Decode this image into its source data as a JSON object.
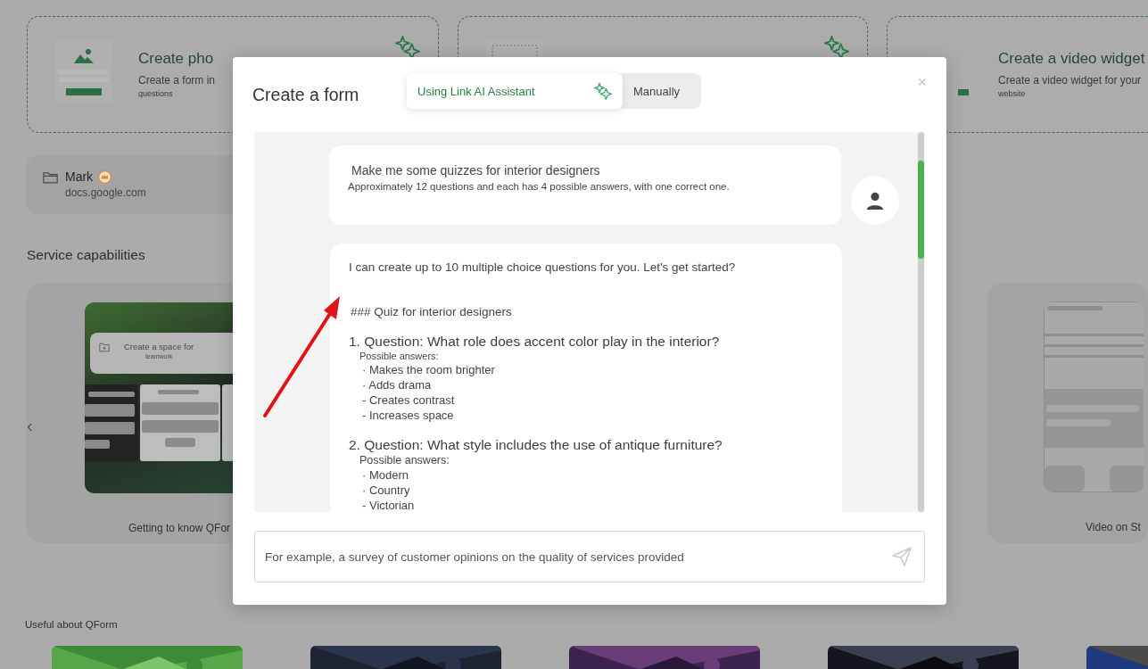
{
  "background": {
    "top_cards": [
      {
        "title": "Create pho",
        "description": "Create a form in",
        "subtext": "questions",
        "sparkle": true
      },
      {
        "kind": "grid",
        "sparkle": true
      },
      {
        "kind": "video",
        "title": "Create a video widget",
        "description": "Create a video widget for your",
        "subtext": "website",
        "sparkle": false
      }
    ],
    "folder": {
      "name": "Mark",
      "url": "docs.google.com",
      "premium": true
    },
    "section_title": "Service capabilities",
    "carousel_prev": "‹",
    "capability_cards": [
      {
        "caption": "Getting to know QFor",
        "preview": {
          "kind": "teamwork",
          "title": "Create a space for",
          "subtitle": "teamwork"
        }
      },
      {
        "caption": "Video on St",
        "preview": {
          "kind": "form"
        }
      }
    ],
    "useful_title": "Useful about QForm"
  },
  "modal": {
    "title": "Create a form",
    "close": "×",
    "modes": [
      {
        "label": "Using Link AI Assistant",
        "selected": true
      },
      {
        "label": "Manually",
        "selected": false
      }
    ],
    "messages": [
      {
        "kind": "user",
        "title": "Make me some quizzes for interior designers",
        "text": "Approximately 12 questions and each has 4 possible answers, with one correct one."
      },
      {
        "kind": "assistant",
        "intro": "I can create up to 10 multiple choice questions for you. Let's get started?",
        "heading": "### Quiz for interior designers",
        "questions": [
          {
            "text": "1. Question: What role does accent color play in the interior?",
            "answers_label": "Possible answers:",
            "answers": [
              "· Makes the room brighter",
              "· Adds drama",
              "- Creates contrast",
              "- Increases space"
            ]
          },
          {
            "text": "2. Question: What style includes the use of antique furniture?",
            "answers_label": "Possible answers:",
            "answers": [
              "· Modern",
              "· Country",
              "- Victorian"
            ]
          }
        ]
      }
    ],
    "input": {
      "placeholder": "For example, a survey of customer opinions on the quality of services provided"
    }
  }
}
